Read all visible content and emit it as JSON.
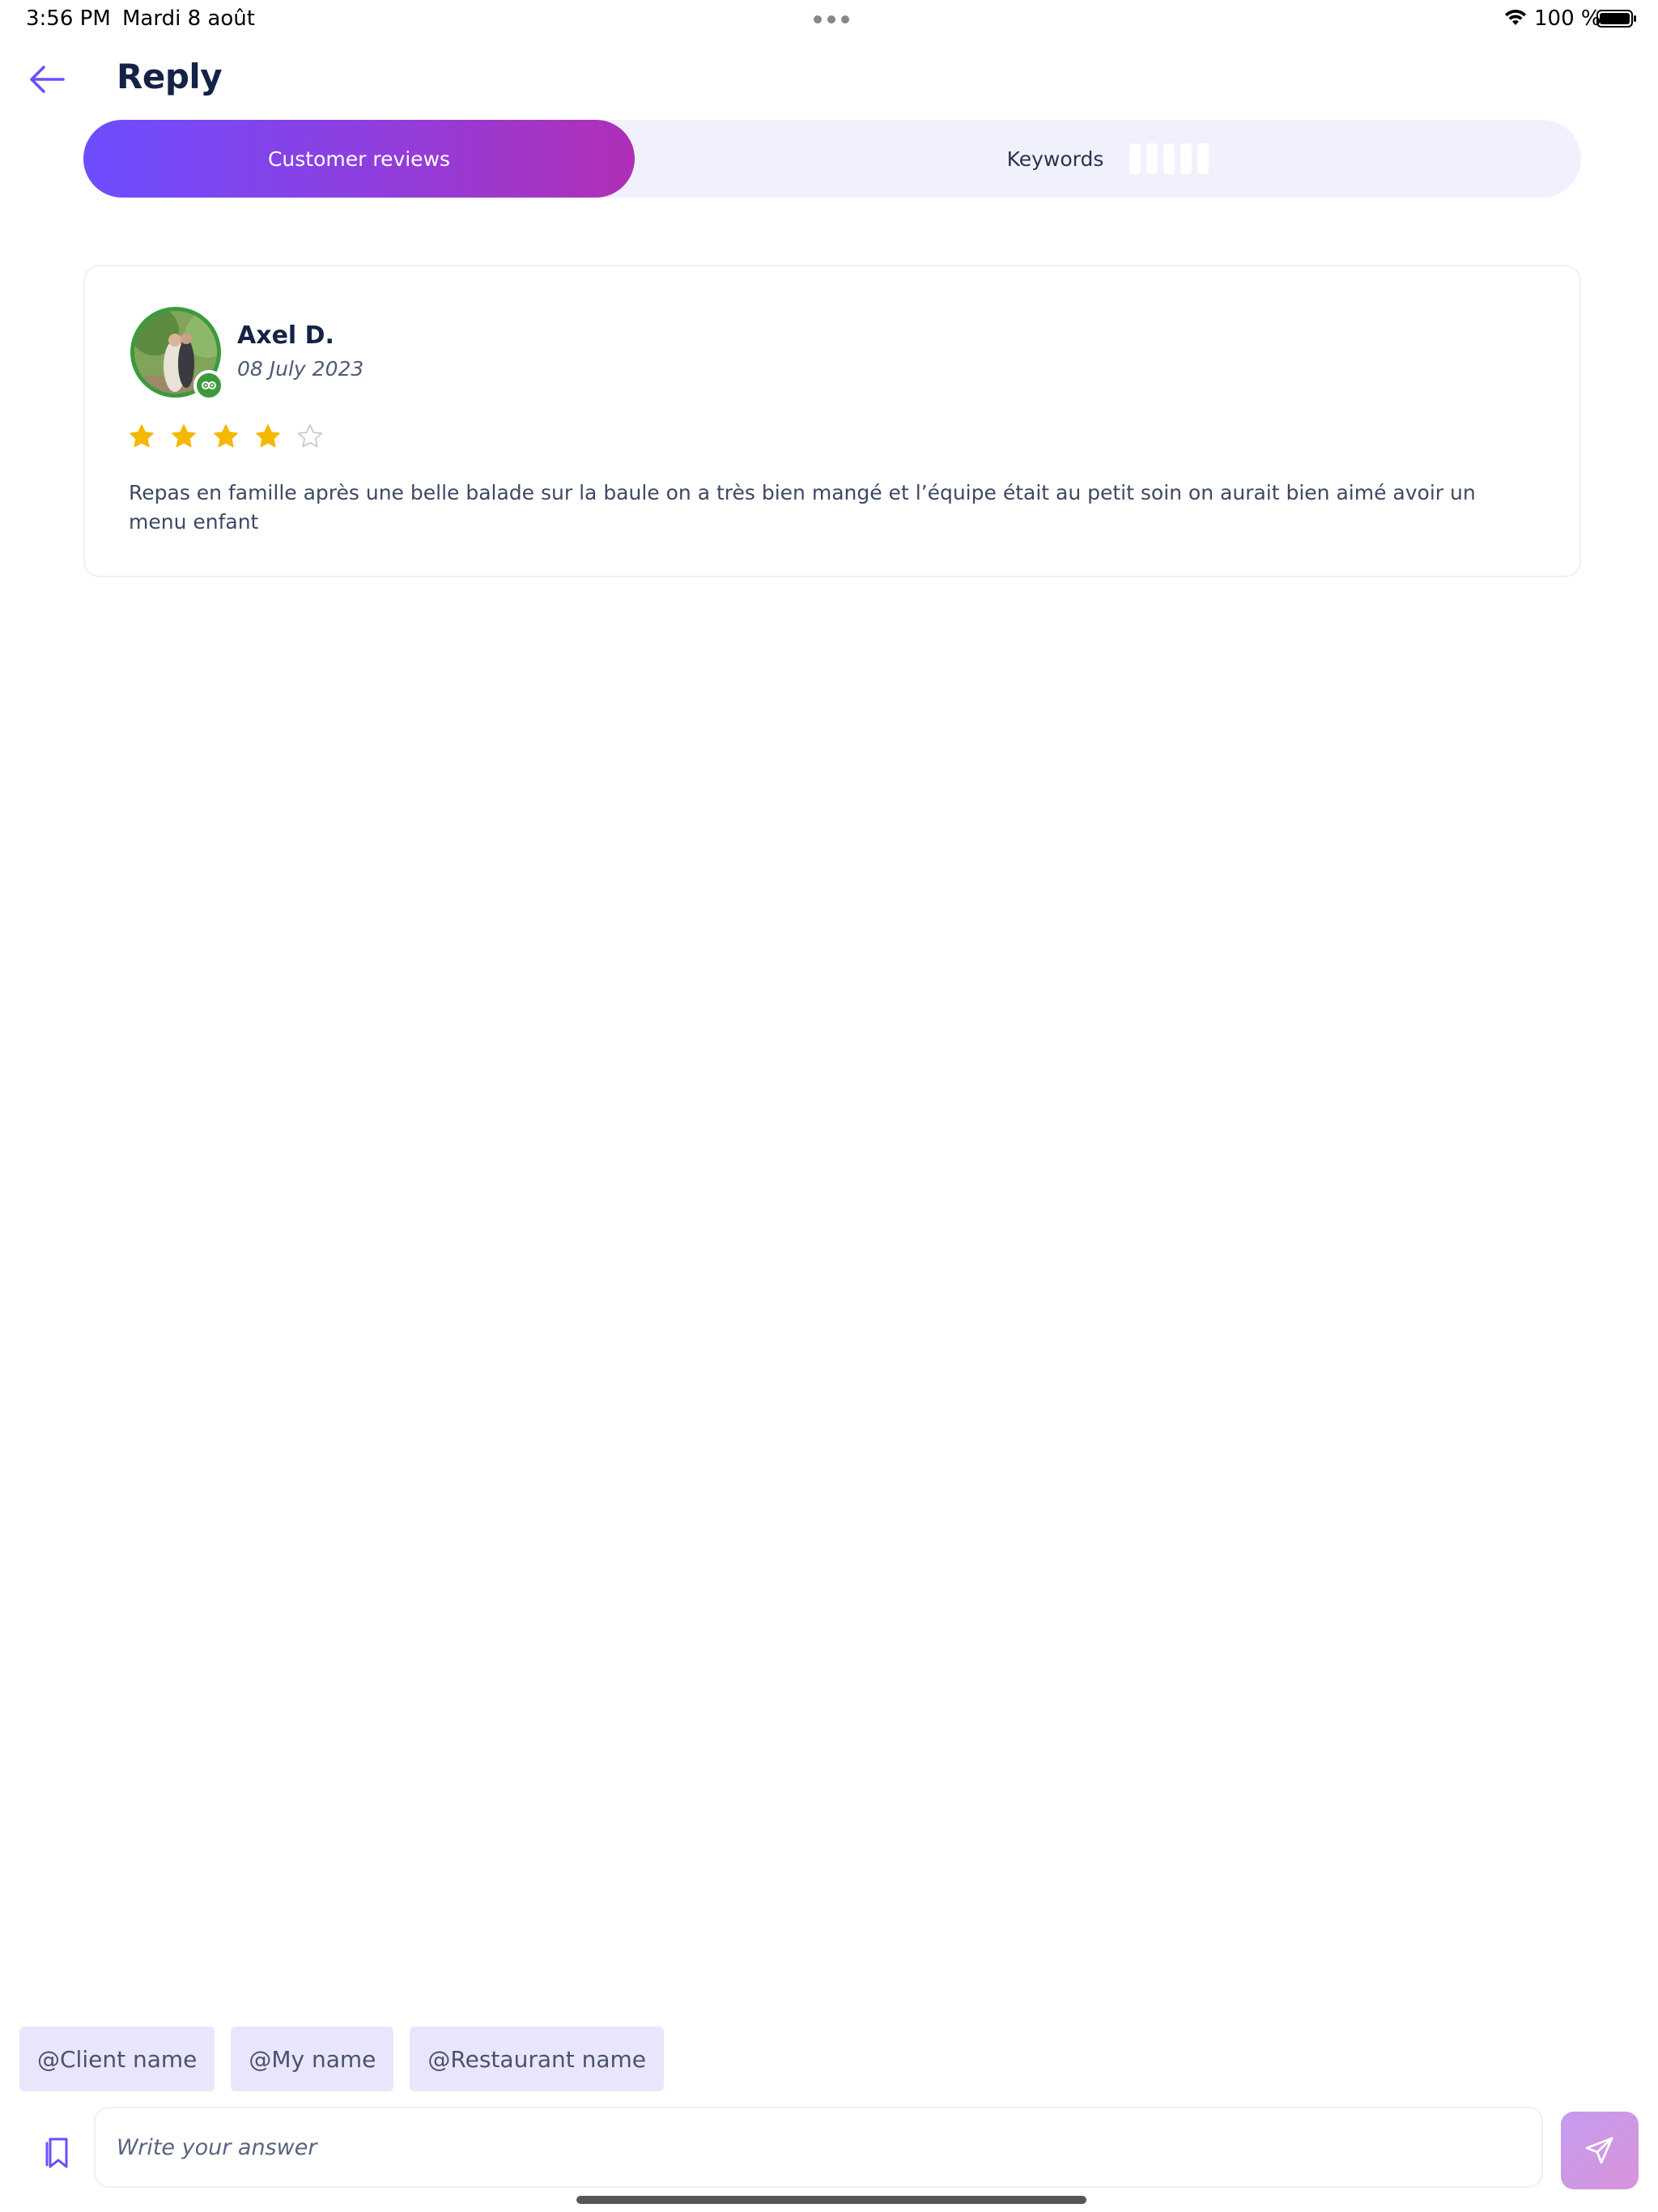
{
  "status_bar": {
    "time": "3:56 PM",
    "date": "Mardi 8 août",
    "battery": "100 %"
  },
  "header": {
    "title": "Reply",
    "back_icon": "arrow-left-icon"
  },
  "tabs": [
    {
      "label": "Customer reviews",
      "active": true
    },
    {
      "label": "Keywords",
      "active": false
    }
  ],
  "review": {
    "author": "Axel D.",
    "date": "08 July 2023",
    "rating": 4,
    "max_rating": 5,
    "text": "Repas en famille après une belle balade sur la baule on a très bien mangé et l’équipe était au petit soin on aurait bien aimé avoir un menu enfant",
    "source_icon": "tripadvisor-icon"
  },
  "mentions": [
    "@Client name",
    "@My name",
    "@Restaurant name"
  ],
  "composer": {
    "placeholder": "Write your answer",
    "value": ""
  },
  "colors": {
    "accent": "#6d4dff",
    "accent_end": "#b02fb6",
    "star": "#f5b800",
    "star_empty": "#c9c9d1",
    "avatar_ring": "#3c9a3c",
    "chip_bg": "#e9e6fb"
  }
}
